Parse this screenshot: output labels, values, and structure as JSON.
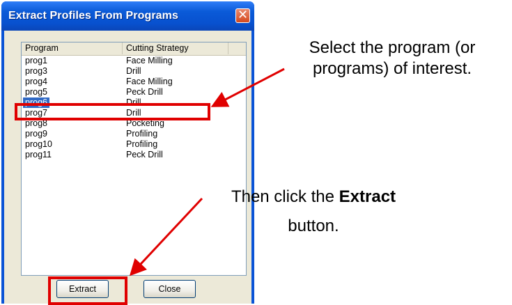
{
  "window": {
    "title": "Extract Profiles From Programs",
    "close_glyph": "✕"
  },
  "list": {
    "columns": [
      "Program",
      "Cutting Strategy"
    ],
    "rows": [
      {
        "program": "prog1",
        "strategy": "Face Milling",
        "selected": false
      },
      {
        "program": "prog3",
        "strategy": "Drill",
        "selected": false
      },
      {
        "program": "prog4",
        "strategy": "Face Milling",
        "selected": false
      },
      {
        "program": "prog5",
        "strategy": "Peck Drill",
        "selected": false
      },
      {
        "program": "prog6",
        "strategy": "Drill",
        "selected": true
      },
      {
        "program": "prog7",
        "strategy": "Drill",
        "selected": false
      },
      {
        "program": "prog8",
        "strategy": "Pocketing",
        "selected": false
      },
      {
        "program": "prog9",
        "strategy": "Profiling",
        "selected": false
      },
      {
        "program": "prog10",
        "strategy": "Profiling",
        "selected": false
      },
      {
        "program": "prog11",
        "strategy": "Peck Drill",
        "selected": false
      }
    ]
  },
  "buttons": {
    "extract": "Extract",
    "close": "Close"
  },
  "annotations": {
    "select_line1": "Select the program (or",
    "select_line2": "programs) of interest.",
    "then_prefix": "Then click the ",
    "then_bold": "Extract",
    "then_line2": "button."
  },
  "colors": {
    "titlebar": "#0a54d6",
    "selection": "#316ac5",
    "highlight": "#e00000",
    "dialog_bg": "#ece9d8"
  }
}
